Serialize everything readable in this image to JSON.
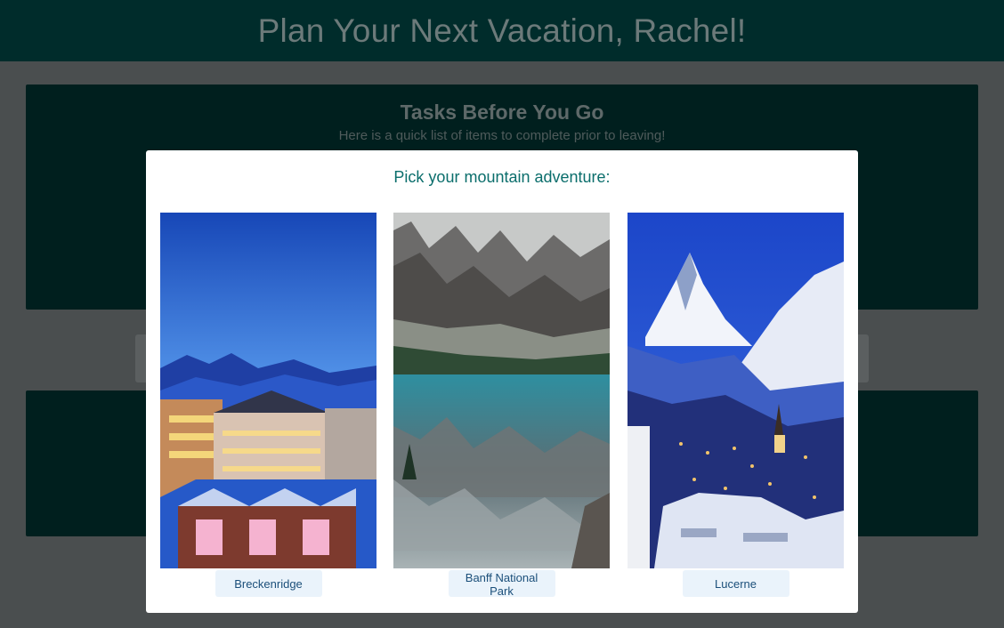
{
  "header": {
    "title": "Plan Your Next Vacation, Rachel!"
  },
  "tasks": {
    "title": "Tasks Before You Go",
    "subtitle": "Here is a quick list of items to complete prior to leaving!"
  },
  "modal": {
    "title": "Pick your mountain adventure:",
    "options": [
      {
        "label": "Breckenridge",
        "photo": "ski-town-night-photo"
      },
      {
        "label": "Banff National Park",
        "photo": "mountain-lake-reflection-photo"
      },
      {
        "label": "Lucerne",
        "photo": "alpine-village-peak-photo"
      }
    ]
  }
}
